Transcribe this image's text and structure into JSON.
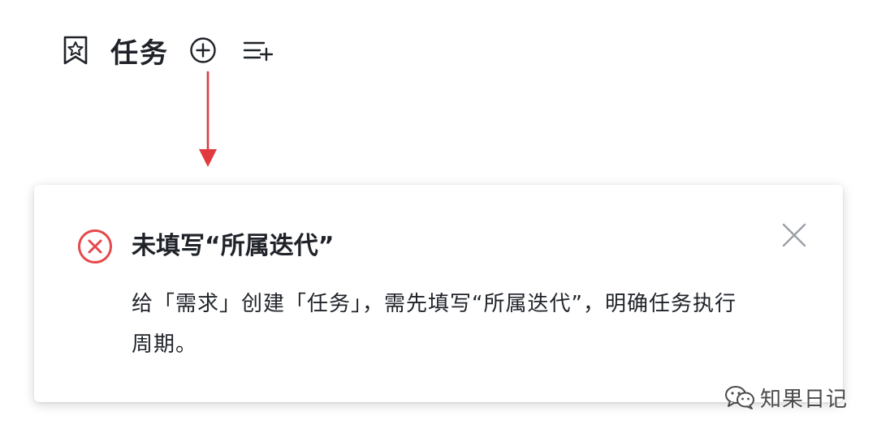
{
  "header": {
    "title": "任务"
  },
  "notice": {
    "title": "未填写“所属迭代”",
    "body": "给「需求」创建「任务」，需先填写“所属迭代”，明确任务执行周期。",
    "colors": {
      "error": "#e5484d",
      "close": "#9aa0a6"
    }
  },
  "annotation": {
    "arrow_color": "#e0393e"
  },
  "watermark": {
    "text": "知果日记"
  },
  "icons": {
    "star_tag": "star-tag-icon",
    "add": "add-circle-icon",
    "list_add": "list-add-icon",
    "error": "error-circle-icon",
    "close": "close-icon",
    "wechat": "wechat-icon"
  }
}
